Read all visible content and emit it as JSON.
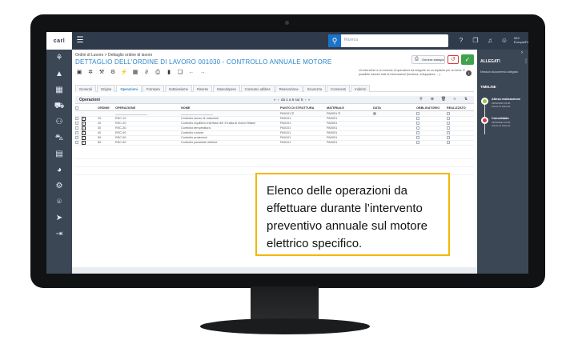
{
  "app": {
    "logo": "carl",
    "search_placeholder": "Ricerca",
    "user_label": "MIC Europa/Paris"
  },
  "breadcrumb": "Ordini di Lavoro > Dettaglio ordine di lavoro",
  "page_title": "DETTAGLIO DELL'ORDINE DI LAVORO 001030 - CONTROLLO ANNUALE MOTORE",
  "actions": {
    "print_label": "Genera stampa"
  },
  "info_note": "Un intervento è un insieme di operazioni da eseguire su un impianto per un bene. È possibile inserire tutte le informazioni (fornitura, sviluppatore, ...)",
  "tabs": [
    "Generali",
    "Origine",
    "Operazioni",
    "Fornitura",
    "Sottoinsieme",
    "Risorse",
    "Manodopera",
    "Consumo utilities",
    "Riservazione",
    "Sicurezza",
    "Commenti",
    "Indirizzi"
  ],
  "active_tab": "Operazioni",
  "section": {
    "title": "Operazioni",
    "pager": "da 1 a 6 sur 6"
  },
  "columns": [
    "ORDINE",
    "OPERAZIONE",
    "NOME",
    "PUNTO DI STRUTTURA",
    "MATERIALE",
    "DATA",
    "OBBLIGATORIO",
    "REALIZZATO"
  ],
  "filter_values": {
    "punto": "PA0101",
    "materiale": "PA0001"
  },
  "rows": [
    {
      "ordine": "10",
      "operazione": "RSC-10",
      "nome": "Controllo senso di rotazione",
      "punto": "PA0101",
      "materiale": "PA0001"
    },
    {
      "ordine": "20",
      "operazione": "RSC-20",
      "nome": "Controllo equilibrio interfase dei 3 tratta di motori trifase",
      "punto": "PA0101",
      "materiale": "PA0001"
    },
    {
      "ordine": "30",
      "operazione": "RSC-30",
      "nome": "Controllo temperatura",
      "punto": "PA0101",
      "materiale": "PA0001"
    },
    {
      "ordine": "40",
      "operazione": "RSC-40",
      "nome": "Controllo rumore",
      "punto": "PA0101",
      "materiale": "PA0001"
    },
    {
      "ordine": "50",
      "operazione": "RSC-50",
      "nome": "Controllo protezioni",
      "punto": "PA0101",
      "materiale": "PA0001"
    },
    {
      "ordine": "60",
      "operazione": "RSC-60",
      "nome": "Controllo parametri elettrici",
      "punto": "PA0101",
      "materiale": "PA0001"
    }
  ],
  "right_panel": {
    "header": "ALLEGATI",
    "subtitle": "Nessun documento allegato",
    "timeline_title": "TIMELINE",
    "events": [
      {
        "title": "Attesa realizzazione",
        "date": "19/02/2022 10:00",
        "who": "Utente di sistema"
      },
      {
        "title": "Convalidato",
        "date": "19/02/2022 10:00",
        "who": "Utente di sistema"
      }
    ]
  },
  "callout": "Elenco delle operazioni da effettuare durante l’intervento preventivo annuale sul motore elettrico specifico.",
  "colors": {
    "accent": "#2d86c8",
    "topbar": "#2f3a4a",
    "sidebar": "#3c4756",
    "callout_border": "#f2b705",
    "confirm": "#3ea34a",
    "cancel": "#d43b3b"
  }
}
